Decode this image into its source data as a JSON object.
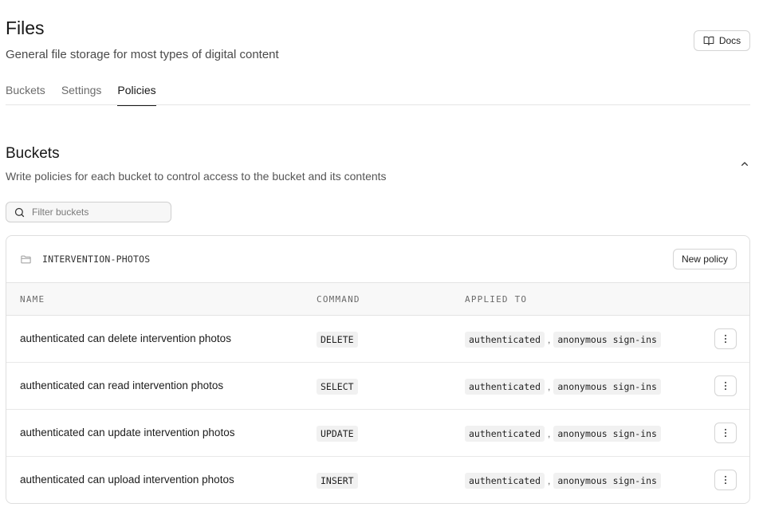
{
  "header": {
    "title": "Files",
    "subtitle": "General file storage for most types of digital content",
    "docs_label": "Docs"
  },
  "tabs": [
    {
      "label": "Buckets",
      "active": false
    },
    {
      "label": "Settings",
      "active": false
    },
    {
      "label": "Policies",
      "active": true
    }
  ],
  "section": {
    "title": "Buckets",
    "description": "Write policies for each bucket to control access to the bucket and its contents"
  },
  "filter": {
    "placeholder": "Filter buckets",
    "value": ""
  },
  "bucket": {
    "name": "INTERVENTION-PHOTOS",
    "new_policy_label": "New policy",
    "columns": [
      "NAME",
      "COMMAND",
      "APPLIED TO"
    ],
    "policies": [
      {
        "name": "authenticated can delete intervention photos",
        "command": "DELETE",
        "applied_to": [
          "authenticated",
          "anonymous sign-ins"
        ]
      },
      {
        "name": "authenticated can read intervention photos",
        "command": "SELECT",
        "applied_to": [
          "authenticated",
          "anonymous sign-ins"
        ]
      },
      {
        "name": "authenticated can update intervention photos",
        "command": "UPDATE",
        "applied_to": [
          "authenticated",
          "anonymous sign-ins"
        ]
      },
      {
        "name": "authenticated can upload intervention photos",
        "command": "INSERT",
        "applied_to": [
          "authenticated",
          "anonymous sign-ins"
        ]
      }
    ],
    "separator": ","
  },
  "icons": {
    "docs": "book-open-icon",
    "collapse": "chevron-up-icon",
    "filter": "search-icon",
    "bucket": "folder-icon",
    "row_action": "more-vertical-icon"
  }
}
